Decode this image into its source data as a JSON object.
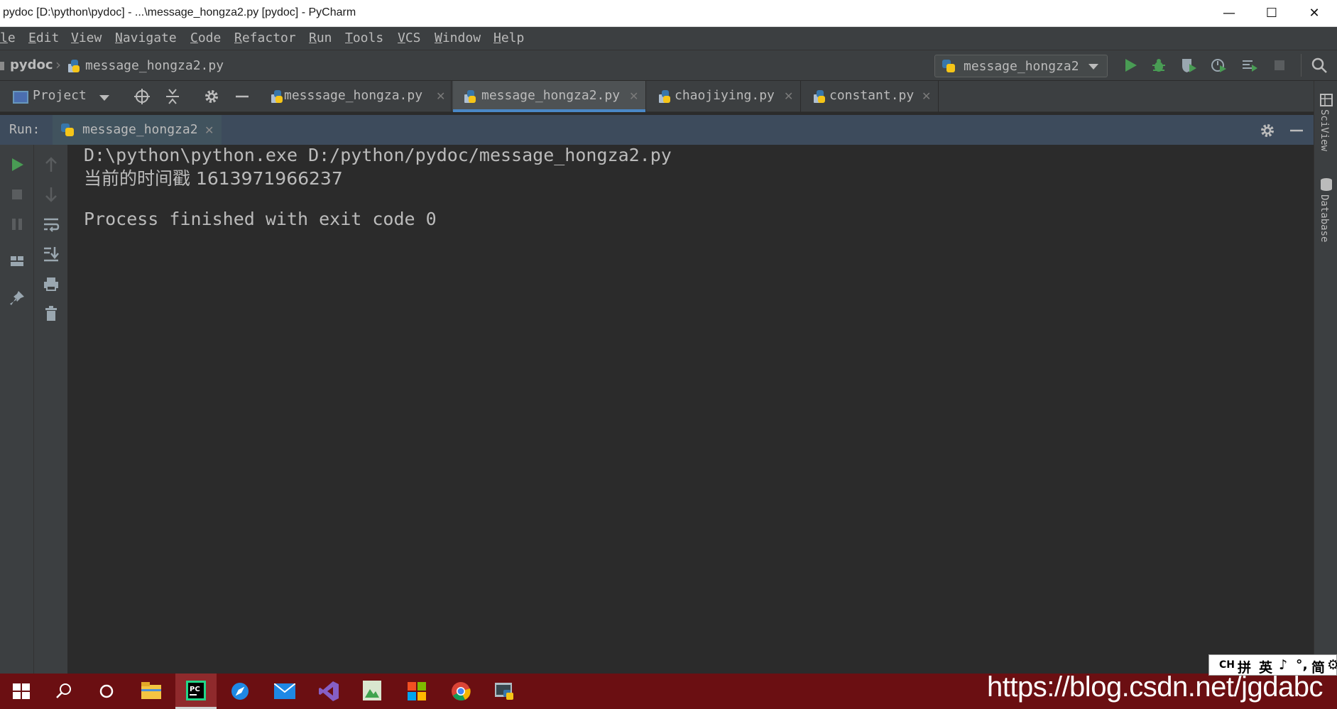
{
  "window": {
    "title": "pydoc [D:\\python\\pydoc] - ...\\message_hongza2.py [pydoc] - PyCharm",
    "minimize": "—",
    "maximize": "☐",
    "close": "✕"
  },
  "menu": [
    "le",
    "Edit",
    "View",
    "Navigate",
    "Code",
    "Refactor",
    "Run",
    "Tools",
    "VCS",
    "Window",
    "Help"
  ],
  "navbar": {
    "project": "pydoc",
    "file": "message_hongza2.py",
    "run_config": "message_hongza2"
  },
  "toolwindow": {
    "project_label": "Project"
  },
  "editor_tabs": [
    {
      "label": "messsage_hongza.py",
      "active": false
    },
    {
      "label": "message_hongza2.py",
      "active": true
    },
    {
      "label": "chaojiying.py",
      "active": false
    },
    {
      "label": "constant.py",
      "active": false
    }
  ],
  "run": {
    "label": "Run:",
    "tab": "message_hongza2"
  },
  "console": {
    "lines": [
      "D:\\python\\python.exe D:/python/pydoc/message_hongza2.py",
      "当前的时间戳 1613971966237",
      "",
      "Process finished with exit code 0"
    ]
  },
  "right_strip": [
    "SciView",
    "Database"
  ],
  "ime": [
    "CH",
    "拼",
    "英",
    "♪",
    "°,",
    "简",
    "⚙"
  ],
  "watermark": "https://blog.csdn.net/jgdabc",
  "colors": {
    "run_green": "#499c54",
    "accent_blue": "#4a88c7",
    "taskbar": "#6b0f12"
  }
}
